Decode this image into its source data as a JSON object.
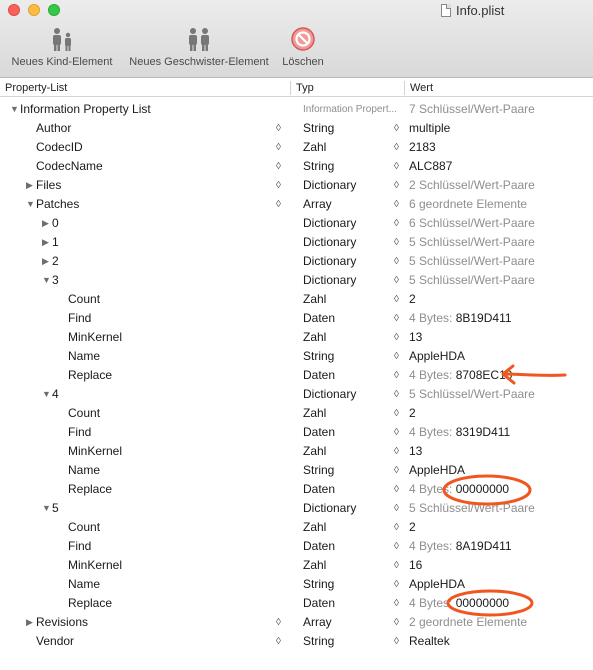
{
  "window": {
    "title": "Info.plist"
  },
  "toolbar": {
    "add_child_label": "Neues Kind-Element",
    "add_sibling_label": "Neues Geschwister-Element",
    "delete_label": "Löschen"
  },
  "columns": {
    "key": "Property-List",
    "type": "Typ",
    "value": "Wert"
  },
  "rows": [
    {
      "key": "Information Property List",
      "type": "Information Propert...",
      "value": "7 Schlüssel/Wert-Paare"
    },
    {
      "key": "Author",
      "type": "String",
      "value": "multiple"
    },
    {
      "key": "CodecID",
      "type": "Zahl",
      "value": "2183"
    },
    {
      "key": "CodecName",
      "type": "String",
      "value": "ALC887"
    },
    {
      "key": "Files",
      "type": "Dictionary",
      "value": "2 Schlüssel/Wert-Paare"
    },
    {
      "key": "Patches",
      "type": "Array",
      "value": "6 geordnete Elemente"
    },
    {
      "key": "0",
      "type": "Dictionary",
      "value": "6 Schlüssel/Wert-Paare"
    },
    {
      "key": "1",
      "type": "Dictionary",
      "value": "5 Schlüssel/Wert-Paare"
    },
    {
      "key": "2",
      "type": "Dictionary",
      "value": "5 Schlüssel/Wert-Paare"
    },
    {
      "key": "3",
      "type": "Dictionary",
      "value": "5 Schlüssel/Wert-Paare"
    },
    {
      "key": "Count",
      "type": "Zahl",
      "value": "2"
    },
    {
      "key": "Find",
      "type": "Daten",
      "prefix": "4 Bytes:",
      "value": "8B19D411"
    },
    {
      "key": "MinKernel",
      "type": "Zahl",
      "value": "13"
    },
    {
      "key": "Name",
      "type": "String",
      "value": "AppleHDA"
    },
    {
      "key": "Replace",
      "type": "Daten",
      "prefix": "4 Bytes:",
      "value": "8708EC10"
    },
    {
      "key": "4",
      "type": "Dictionary",
      "value": "5 Schlüssel/Wert-Paare"
    },
    {
      "key": "Count",
      "type": "Zahl",
      "value": "2"
    },
    {
      "key": "Find",
      "type": "Daten",
      "prefix": "4 Bytes:",
      "value": "8319D411"
    },
    {
      "key": "MinKernel",
      "type": "Zahl",
      "value": "13"
    },
    {
      "key": "Name",
      "type": "String",
      "value": "AppleHDA"
    },
    {
      "key": "Replace",
      "type": "Daten",
      "prefix": "4 Bytes:",
      "value": "00000000"
    },
    {
      "key": "5",
      "type": "Dictionary",
      "value": "5 Schlüssel/Wert-Paare"
    },
    {
      "key": "Count",
      "type": "Zahl",
      "value": "2"
    },
    {
      "key": "Find",
      "type": "Daten",
      "prefix": "4 Bytes:",
      "value": "8A19D411"
    },
    {
      "key": "MinKernel",
      "type": "Zahl",
      "value": "16"
    },
    {
      "key": "Name",
      "type": "String",
      "value": "AppleHDA"
    },
    {
      "key": "Replace",
      "type": "Daten",
      "prefix": "4 Bytes:",
      "value": "00000000"
    },
    {
      "key": "Revisions",
      "type": "Array",
      "value": "2 geordnete Elemente"
    },
    {
      "key": "Vendor",
      "type": "String",
      "value": "Realtek"
    }
  ],
  "annotation_color": "#f0561f"
}
